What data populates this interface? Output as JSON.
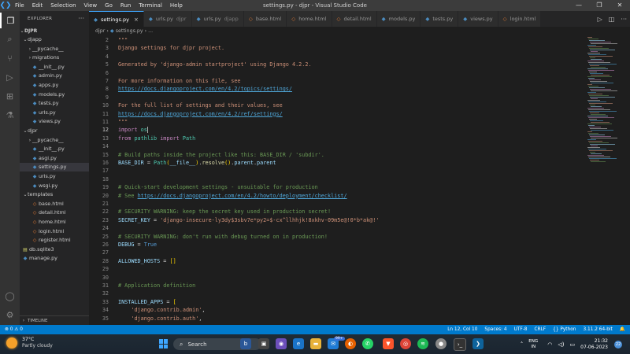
{
  "titlebar": {
    "menu": [
      "File",
      "Edit",
      "Selection",
      "View",
      "Go",
      "Run",
      "Terminal",
      "Help"
    ],
    "title": "settings.py - djpr - Visual Studio Code",
    "controls": [
      "—",
      "❐",
      "✕"
    ]
  },
  "sidebar": {
    "header": "EXPLORER",
    "root": "DJPR",
    "tree": [
      {
        "label": "djapp",
        "type": "folder-open",
        "depth": 1
      },
      {
        "label": "__pycache__",
        "type": "folder",
        "depth": 2
      },
      {
        "label": "migrations",
        "type": "folder",
        "depth": 2
      },
      {
        "label": "__init__.py",
        "type": "py",
        "depth": 2
      },
      {
        "label": "admin.py",
        "type": "py",
        "depth": 2
      },
      {
        "label": "apps.py",
        "type": "py",
        "depth": 2
      },
      {
        "label": "models.py",
        "type": "py",
        "depth": 2
      },
      {
        "label": "tests.py",
        "type": "py",
        "depth": 2
      },
      {
        "label": "urls.py",
        "type": "py",
        "depth": 2
      },
      {
        "label": "views.py",
        "type": "py",
        "depth": 2
      },
      {
        "label": "djpr",
        "type": "folder-open",
        "depth": 1
      },
      {
        "label": "__pycache__",
        "type": "folder",
        "depth": 2
      },
      {
        "label": "__init__.py",
        "type": "py",
        "depth": 2
      },
      {
        "label": "asgi.py",
        "type": "py",
        "depth": 2
      },
      {
        "label": "settings.py",
        "type": "py",
        "depth": 2,
        "selected": true
      },
      {
        "label": "urls.py",
        "type": "py",
        "depth": 2
      },
      {
        "label": "wsgi.py",
        "type": "py",
        "depth": 2
      },
      {
        "label": "templates",
        "type": "folder-open",
        "depth": 1
      },
      {
        "label": "base.html",
        "type": "html",
        "depth": 2
      },
      {
        "label": "detail.html",
        "type": "html",
        "depth": 2
      },
      {
        "label": "home.html",
        "type": "html",
        "depth": 2
      },
      {
        "label": "login.html",
        "type": "html",
        "depth": 2
      },
      {
        "label": "register.html",
        "type": "html",
        "depth": 2
      },
      {
        "label": "db.sqlite3",
        "type": "db",
        "depth": 1
      },
      {
        "label": "manage.py",
        "type": "py",
        "depth": 1
      }
    ],
    "timeline": "TIMELINE"
  },
  "tabs": [
    {
      "label": "settings.py",
      "type": "py",
      "active": true
    },
    {
      "label": "urls.py",
      "suffix": "djpr",
      "type": "py"
    },
    {
      "label": "urls.py",
      "suffix": "djapp",
      "type": "py"
    },
    {
      "label": "base.html",
      "type": "html"
    },
    {
      "label": "home.html",
      "type": "html"
    },
    {
      "label": "detail.html",
      "type": "html"
    },
    {
      "label": "models.py",
      "type": "py"
    },
    {
      "label": "tests.py",
      "type": "py"
    },
    {
      "label": "views.py",
      "type": "py"
    },
    {
      "label": "login.html",
      "type": "html"
    }
  ],
  "breadcrumb": [
    "djpr",
    "settings.py",
    "..."
  ],
  "editor": {
    "cursor_line": 12,
    "lines": [
      {
        "n": 2,
        "t": [
          [
            "doc",
            "\"\"\""
          ]
        ]
      },
      {
        "n": 3,
        "t": [
          [
            "doc",
            "Django settings for djpr project."
          ]
        ]
      },
      {
        "n": 4,
        "t": []
      },
      {
        "n": 5,
        "t": [
          [
            "doc",
            "Generated by 'django-admin startproject' using Django 4.2.2."
          ]
        ]
      },
      {
        "n": 6,
        "t": []
      },
      {
        "n": 7,
        "t": [
          [
            "doc",
            "For more information on this file, see"
          ]
        ]
      },
      {
        "n": 8,
        "t": [
          [
            "lnk",
            "https://docs.djangoproject.com/en/4.2/topics/settings/"
          ]
        ]
      },
      {
        "n": 9,
        "t": []
      },
      {
        "n": 10,
        "t": [
          [
            "doc",
            "For the full list of settings and their values, see"
          ]
        ]
      },
      {
        "n": 11,
        "t": [
          [
            "lnk",
            "https://docs.djangoproject.com/en/4.2/ref/settings/"
          ]
        ]
      },
      {
        "n": 11,
        "t": [
          [
            "doc",
            "\"\"\""
          ]
        ]
      },
      {
        "n": 12,
        "t": [
          [
            "kw",
            "import"
          ],
          [
            "plain",
            " "
          ],
          [
            "cls",
            "os"
          ]
        ]
      },
      {
        "n": 13,
        "t": [
          [
            "kw",
            "from"
          ],
          [
            "plain",
            " "
          ],
          [
            "cls",
            "pathlib"
          ],
          [
            "plain",
            " "
          ],
          [
            "kw",
            "import"
          ],
          [
            "plain",
            " "
          ],
          [
            "cls",
            "Path"
          ]
        ]
      },
      {
        "n": 14,
        "t": []
      },
      {
        "n": 15,
        "t": [
          [
            "cm",
            "# Build paths inside the project like this: BASE_DIR / 'subdir'."
          ]
        ]
      },
      {
        "n": 16,
        "t": [
          [
            "var",
            "BASE_DIR"
          ],
          [
            "plain",
            " = "
          ],
          [
            "cls",
            "Path"
          ],
          [
            "br",
            "("
          ],
          [
            "var",
            "__file__"
          ],
          [
            "br",
            ")"
          ],
          [
            "plain",
            "."
          ],
          [
            "fn",
            "resolve"
          ],
          [
            "br",
            "()"
          ],
          [
            "plain",
            "."
          ],
          [
            "var",
            "parent"
          ],
          [
            "plain",
            "."
          ],
          [
            "var",
            "parent"
          ]
        ]
      },
      {
        "n": 17,
        "t": []
      },
      {
        "n": 18,
        "t": []
      },
      {
        "n": 19,
        "t": [
          [
            "cm",
            "# Quick-start development settings - unsuitable for production"
          ]
        ]
      },
      {
        "n": 20,
        "t": [
          [
            "cm",
            "# See "
          ],
          [
            "lnk",
            "https://docs.djangoproject.com/en/4.2/howto/deployment/checklist/"
          ]
        ]
      },
      {
        "n": 21,
        "t": []
      },
      {
        "n": 22,
        "t": [
          [
            "cm",
            "# SECURITY WARNING: keep the secret key used in production secret!"
          ]
        ]
      },
      {
        "n": 23,
        "t": [
          [
            "var",
            "SECRET_KEY"
          ],
          [
            "plain",
            " = "
          ],
          [
            "str",
            "'django-insecure-ly3dy$3sbv7e*py2=$-cx^llhhjk!8xkhv-09m5e@!0*b*ak@!'"
          ]
        ]
      },
      {
        "n": 24,
        "t": []
      },
      {
        "n": 25,
        "t": [
          [
            "cm",
            "# SECURITY WARNING: don't run with debug turned on in production!"
          ]
        ]
      },
      {
        "n": 26,
        "t": [
          [
            "var",
            "DEBUG"
          ],
          [
            "plain",
            " = "
          ],
          [
            "num",
            "True"
          ]
        ]
      },
      {
        "n": 27,
        "t": []
      },
      {
        "n": 28,
        "t": [
          [
            "var",
            "ALLOWED_HOSTS"
          ],
          [
            "plain",
            " = "
          ],
          [
            "br",
            "[]"
          ]
        ]
      },
      {
        "n": 29,
        "t": []
      },
      {
        "n": 30,
        "t": []
      },
      {
        "n": 31,
        "t": [
          [
            "cm",
            "# Application definition"
          ]
        ]
      },
      {
        "n": 32,
        "t": []
      },
      {
        "n": 33,
        "t": [
          [
            "var",
            "INSTALLED_APPS"
          ],
          [
            "plain",
            " = "
          ],
          [
            "br",
            "["
          ]
        ]
      },
      {
        "n": 34,
        "t": [
          [
            "plain",
            "    "
          ],
          [
            "str",
            "'django.contrib.admin'"
          ],
          [
            "plain",
            ","
          ]
        ]
      },
      {
        "n": 35,
        "t": [
          [
            "plain",
            "    "
          ],
          [
            "str",
            "'django.contrib.auth'"
          ],
          [
            "plain",
            ","
          ]
        ]
      }
    ]
  },
  "statusbar": {
    "left": "⊗ 0  ⚠ 0",
    "right": [
      "Ln 12, Col 10",
      "Spaces: 4",
      "UTF-8",
      "CRLF",
      "{} Python",
      "3.11.2 64-bit",
      "🔔"
    ]
  },
  "taskbar": {
    "weather_temp": "37°C",
    "weather_desc": "Partly cloudy",
    "search": "Search",
    "badge": "99+",
    "lang1": "ENG",
    "lang2": "IN",
    "time": "21:32",
    "date": "07-06-2023",
    "notif": "22"
  },
  "colors": {
    "accent": "#007acc",
    "activity_bar": "#333333",
    "sidebar": "#252526",
    "editor": "#1e1e1e"
  }
}
